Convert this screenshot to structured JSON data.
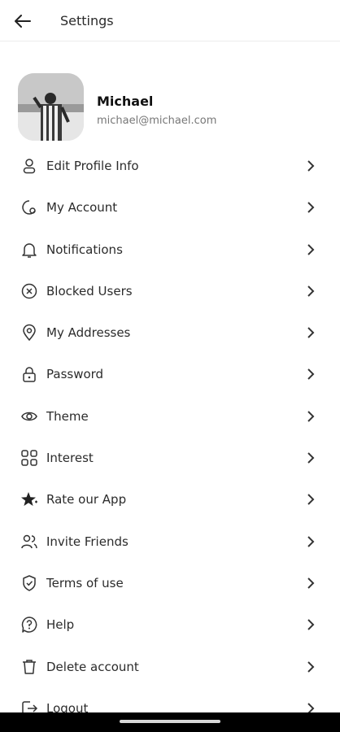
{
  "header": {
    "title": "Settings"
  },
  "profile": {
    "name": "Michael",
    "email": "michael@michael.com"
  },
  "menu": [
    {
      "label": "Edit Profile Info",
      "icon": "person-icon"
    },
    {
      "label": "My Account",
      "icon": "account-icon"
    },
    {
      "label": "Notifications",
      "icon": "bell-icon"
    },
    {
      "label": "Blocked Users",
      "icon": "blocked-icon"
    },
    {
      "label": "My Addresses",
      "icon": "location-pin-icon"
    },
    {
      "label": "Password",
      "icon": "lock-icon"
    },
    {
      "label": "Theme",
      "icon": "eye-icon"
    },
    {
      "label": "Interest",
      "icon": "grid-icon"
    },
    {
      "label": "Rate our App",
      "icon": "star-icon"
    },
    {
      "label": "Invite Friends",
      "icon": "users-icon"
    },
    {
      "label": "Terms of use",
      "icon": "shield-check-icon"
    },
    {
      "label": "Help",
      "icon": "help-icon"
    },
    {
      "label": "Delete account",
      "icon": "trash-icon"
    },
    {
      "label": "Logout",
      "icon": "logout-icon"
    }
  ]
}
